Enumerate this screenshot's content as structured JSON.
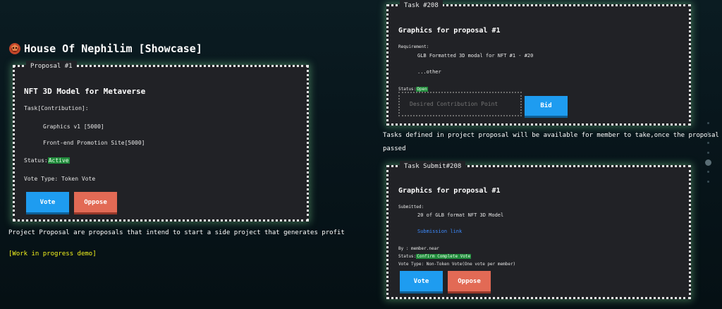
{
  "app": {
    "title": "House Of Nephilim [Showcase]",
    "caption_project": "Project Proposal are proposals that intend to start a side project that generates profit",
    "work_in_progress": "[Work in progress demo]",
    "caption_tasks": "Tasks defined in project proposal will be available for member to take,once the proposal",
    "caption_tasks_2": "passed"
  },
  "proposal": {
    "tab": "Proposal #1",
    "title": "NFT 3D Model for Metaverse",
    "task_header": "Task[Contribution]:",
    "tasks": [
      "Graphics v1 [5000]",
      "Front-end Promotion Site[5000]"
    ],
    "status_label": "Status:",
    "status_value": "Active",
    "vote_type": "Vote Type: Token Vote",
    "vote_label": "Vote",
    "oppose_label": "Oppose"
  },
  "task": {
    "tab": "Task #208",
    "title": "Graphics for proposal #1",
    "requirement_label": "Requirement:",
    "requirement_line": "GLB Formatted 3D modal for NFT #1 - #20",
    "requirement_other": "...other",
    "status_label": "Status:",
    "status_value": "Open",
    "bid_placeholder": "Desired Contribution Point",
    "bid_label": "Bid"
  },
  "submit": {
    "tab": "Task Submit#208",
    "title": "Graphics for proposal #1",
    "submitted_label": "Submitted:",
    "submitted_line": "20 of GLB format NFT 3D Model",
    "submission_link": "Submission link",
    "by_line": "By : member.near",
    "status_label": "Status:",
    "status_value": "Confirm Complete Vote",
    "vote_type": "Vote Type: Non-Token Vote(One vote per member)",
    "vote_label": "Vote",
    "oppose_label": "Oppose"
  },
  "colors": {
    "panel_bg": "#212226",
    "accent_blue": "#1e9cf0",
    "accent_red": "#e26a55",
    "status_green": "#1f8a3a",
    "link_blue": "#3d8bff",
    "highlight_yellow": "#f2f21c"
  }
}
